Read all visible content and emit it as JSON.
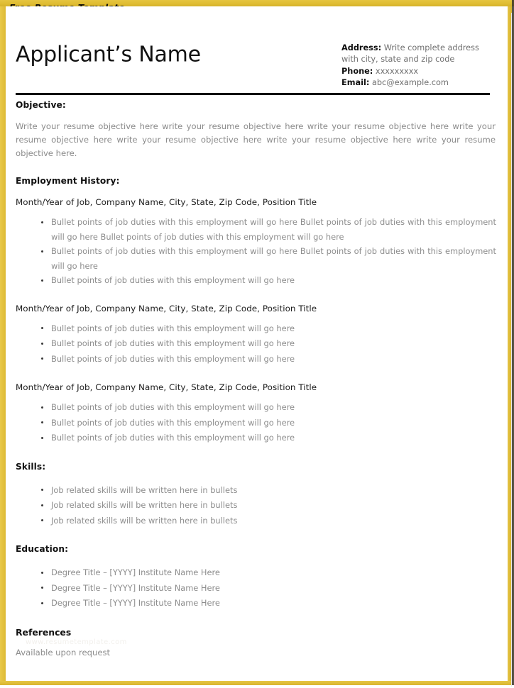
{
  "banner": {
    "label": "Free Resume Template"
  },
  "resume": {
    "name": "Applicant’s Name",
    "contact": {
      "address_label": "Address:",
      "address_value": " Write complete address with city, state and zip code",
      "phone_label": "Phone:",
      "phone_value": " xxxxxxxxx",
      "email_label": "Email:",
      "email_value": " abc@example.com"
    },
    "sections": {
      "objective": {
        "heading": "Objective:",
        "body": "Write your resume objective here write your resume objective here write your resume objective here write your resume objective here write your resume objective here write your resume objective here write your resume objective here."
      },
      "employment": {
        "heading": "Employment History:",
        "jobs": [
          {
            "header": "Month/Year of Job, Company Name, City, State, Zip Code, Position Title",
            "bullets": [
              "Bullet points of job duties with this employment will go here Bullet points of job duties with this employment will go here Bullet points of job duties with this employment will go here",
              "Bullet points of job duties with this employment will go here Bullet points of job duties with this employment will go here",
              "Bullet points of job duties with this employment will go here"
            ]
          },
          {
            "header": "Month/Year of Job, Company Name, City, State, Zip Code, Position Title",
            "bullets": [
              "Bullet points of job duties with this employment will go here",
              "Bullet points of job duties with this employment will go here",
              "Bullet points of job duties with this employment will go here"
            ]
          },
          {
            "header": "Month/Year of Job, Company Name, City, State, Zip Code, Position Title",
            "bullets": [
              "Bullet points of job duties with this employment will go here",
              "Bullet points of job duties with this employment will go here",
              "Bullet points of job duties with this employment will go here"
            ]
          }
        ]
      },
      "skills": {
        "heading": "Skills:",
        "bullets": [
          "Job related skills will be written here in bullets",
          "Job related skills will be written here in bullets",
          "Job related skills will be written here in bullets"
        ]
      },
      "education": {
        "heading": "Education:",
        "bullets": [
          "Degree Title – [YYYY] Institute Name Here",
          "Degree Title – [YYYY] Institute Name Here",
          "Degree Title – [YYYY] Institute Name Here"
        ]
      },
      "references": {
        "heading": "References",
        "watermark": "www.resumetemplate.com",
        "body": "Available upon request"
      }
    }
  },
  "colors": {
    "frame_gold": "#ddba34",
    "rule_black": "#0b0b0b",
    "body_gray": "#8d8d8d",
    "heading_black": "#111111"
  }
}
